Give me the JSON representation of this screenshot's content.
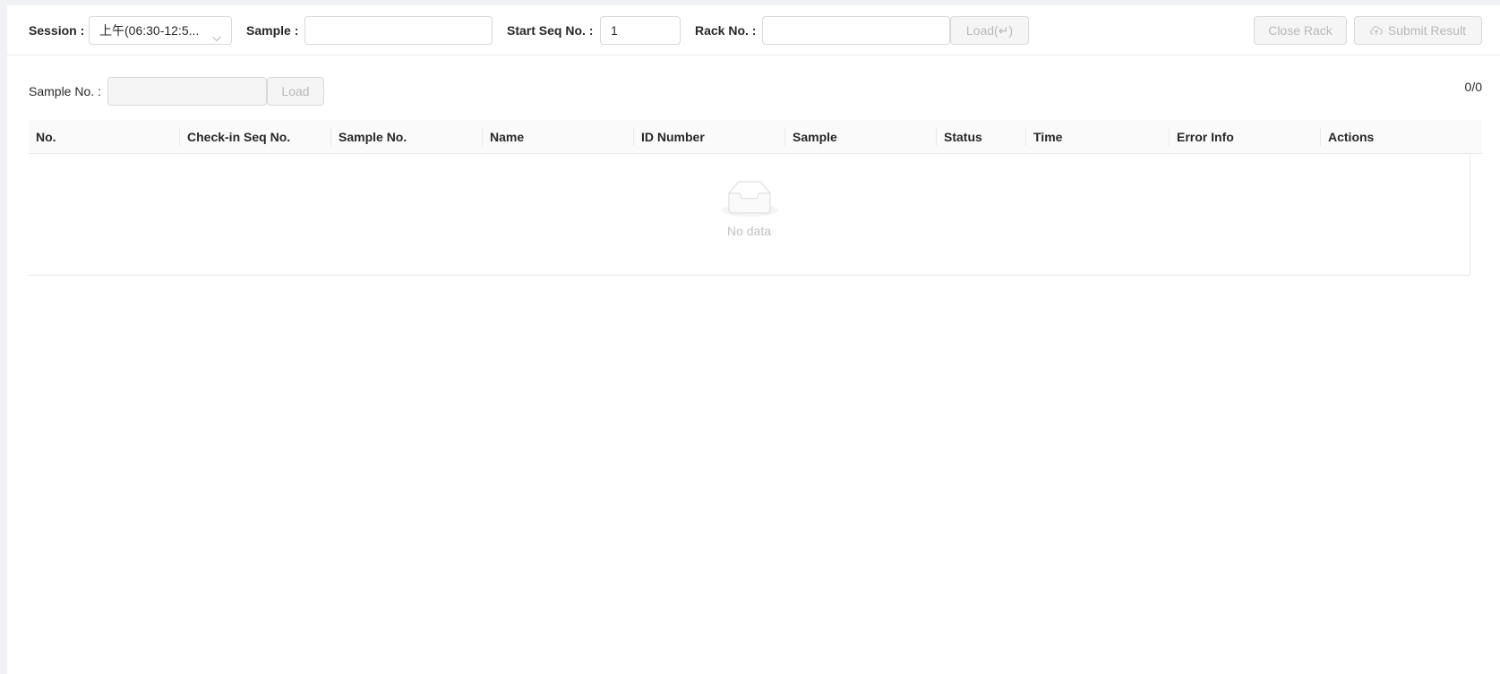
{
  "toolbar": {
    "session_label": "Session",
    "session_value": "上午(06:30-12:5...",
    "sample_label": "Sample",
    "sample_value": "",
    "start_seq_label": "Start Seq No.",
    "start_seq_value": "1",
    "rack_label": "Rack No.",
    "rack_value": "",
    "load_button": "Load(↵)",
    "close_rack_button": "Close Rack",
    "submit_result_button": "Submit Result"
  },
  "sample_search": {
    "label": "Sample No.",
    "value": "",
    "load_button": "Load"
  },
  "counter": "0/0",
  "table": {
    "columns": [
      "No.",
      "Check-in Seq No.",
      "Sample No.",
      "Name",
      "ID Number",
      "Sample",
      "Status",
      "Time",
      "Error Info",
      "Actions"
    ],
    "rows": [],
    "empty_text": "No data"
  },
  "colors": {
    "border": "#d9d9d9",
    "disabled_bg": "#f5f5f5",
    "header_bg": "#fafafa",
    "page_bg": "#f0f2f5"
  }
}
